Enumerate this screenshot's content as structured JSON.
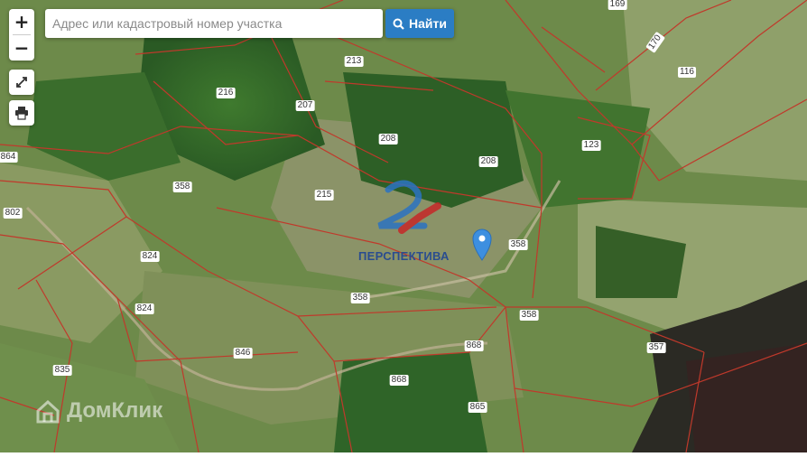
{
  "search": {
    "placeholder": "Адрес или кадастровый номер участка",
    "button_label": "Найти"
  },
  "controls": {
    "zoom_in": "+",
    "zoom_out": "−"
  },
  "parcel_labels": [
    "169",
    "170",
    "116",
    "213",
    "216",
    "207",
    "208",
    "208",
    "123",
    "864",
    "358",
    "215",
    "802",
    "358",
    "824",
    "824",
    "358",
    "358",
    "846",
    "868",
    "835",
    "868",
    "865",
    "357"
  ],
  "watermark": "ДомКлик",
  "overlay_logo_text": "ПЕРСПЕКТИВА",
  "colors": {
    "button": "#2b7dc4",
    "boundary": "#c0392b",
    "marker": "#3d8fe0"
  }
}
